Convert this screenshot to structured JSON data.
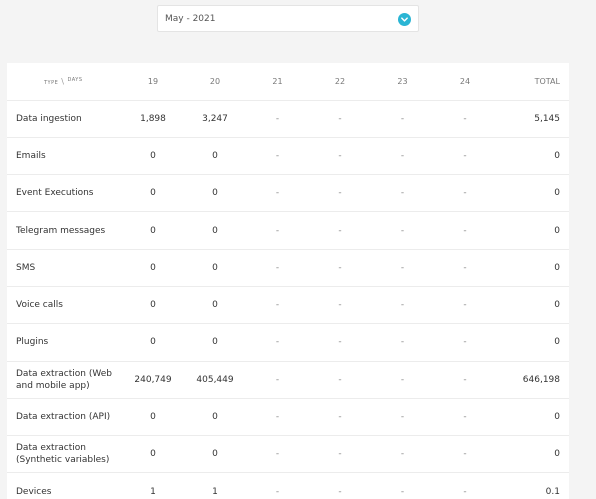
{
  "month_selector": {
    "value": "May - 2021"
  },
  "table": {
    "corner_type": "TYPE",
    "corner_slash": "\\",
    "corner_days": "DAYS",
    "columns": [
      "19",
      "20",
      "21",
      "22",
      "23",
      "24"
    ],
    "total_label": "TOTAL",
    "rows": [
      {
        "label": "Data ingestion",
        "values": [
          "1,898",
          "3,247",
          "-",
          "-",
          "-",
          "-"
        ],
        "total": "5,145"
      },
      {
        "label": "Emails",
        "values": [
          "0",
          "0",
          "-",
          "-",
          "-",
          "-"
        ],
        "total": "0"
      },
      {
        "label": "Event Executions",
        "values": [
          "0",
          "0",
          "-",
          "-",
          "-",
          "-"
        ],
        "total": "0"
      },
      {
        "label": "Telegram messages",
        "values": [
          "0",
          "0",
          "-",
          "-",
          "-",
          "-"
        ],
        "total": "0"
      },
      {
        "label": "SMS",
        "values": [
          "0",
          "0",
          "-",
          "-",
          "-",
          "-"
        ],
        "total": "0"
      },
      {
        "label": "Voice calls",
        "values": [
          "0",
          "0",
          "-",
          "-",
          "-",
          "-"
        ],
        "total": "0"
      },
      {
        "label": "Plugins",
        "values": [
          "0",
          "0",
          "-",
          "-",
          "-",
          "-"
        ],
        "total": "0"
      },
      {
        "label": "Data extraction (Web and mobile app)",
        "values": [
          "240,749",
          "405,449",
          "-",
          "-",
          "-",
          "-"
        ],
        "total": "646,198"
      },
      {
        "label": "Data extraction (API)",
        "values": [
          "0",
          "0",
          "-",
          "-",
          "-",
          "-"
        ],
        "total": "0"
      },
      {
        "label": "Data extraction (Synthetic variables)",
        "values": [
          "0",
          "0",
          "-",
          "-",
          "-",
          "-"
        ],
        "total": "0"
      },
      {
        "label": "Devices",
        "values": [
          "1",
          "1",
          "-",
          "-",
          "-",
          "-"
        ],
        "total": "0.1"
      }
    ]
  },
  "colors": {
    "accent": "#2ab5d4",
    "background": "#f4f4f4"
  }
}
